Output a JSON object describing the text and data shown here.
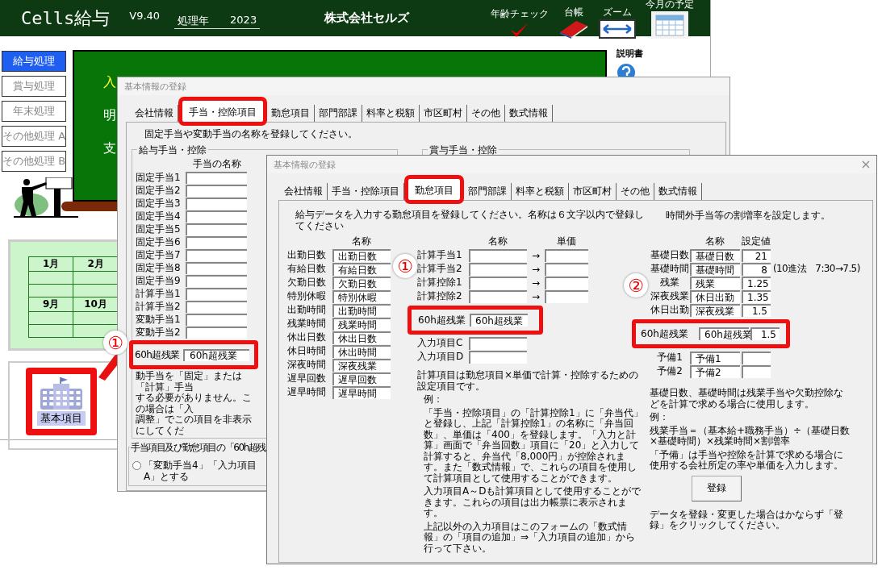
{
  "app": {
    "title": "Cells給与",
    "version": "V9.40",
    "year_label": "処理年",
    "year": "2023",
    "company": "株式会社セルズ",
    "tools": [
      {
        "label": "年齢チェック",
        "kind": "check"
      },
      {
        "label": "台帳",
        "kind": "book"
      },
      {
        "label": "ズーム",
        "kind": "zoom"
      },
      {
        "label": "今月の予定",
        "kind": "calendar"
      }
    ],
    "menu": [
      {
        "label": "給与処理",
        "selected": true
      },
      {
        "label": "賞与処理",
        "selected": false
      },
      {
        "label": "年末処理",
        "selected": false
      },
      {
        "label": "その他処理 A",
        "selected": false
      },
      {
        "label": "その他処理 B",
        "selected": false
      }
    ],
    "banner_chars": [
      {
        "text": "入",
        "color": "#ffff33"
      },
      {
        "text": "明",
        "color": "#ffffff"
      },
      {
        "text": "支",
        "color": "#ffffff"
      }
    ],
    "help": {
      "label": "説明書"
    },
    "calendar": {
      "rows": [
        [
          "1月",
          "2月"
        ],
        [
          null,
          null
        ],
        [
          null,
          null
        ],
        [
          "9月",
          "10月"
        ],
        [
          null,
          null
        ],
        [
          null,
          null
        ]
      ]
    },
    "launch_button": {
      "label": "基本項目"
    }
  },
  "back_dialog": {
    "title": "基本情報の登録",
    "tabs": [
      {
        "label": "会社情報",
        "selected": false
      },
      {
        "label": "手当・控除項目",
        "selected": true
      },
      {
        "label": "勤怠項目",
        "selected": false
      },
      {
        "label": "部門部課",
        "selected": false
      },
      {
        "label": "料率と税額",
        "selected": false
      },
      {
        "label": "市区町村",
        "selected": false
      },
      {
        "label": "その他",
        "selected": false
      },
      {
        "label": "数式情報",
        "selected": false
      }
    ],
    "instruction": "固定手当や変動手当の名称を登録してください。",
    "salary_group": "給与手当・控除",
    "bonus_group": "賞与手当・控除",
    "header": "手当の名称",
    "rows": [
      {
        "label": "固定手当1"
      },
      {
        "label": "固定手当2"
      },
      {
        "label": "固定手当3"
      },
      {
        "label": "固定手当4"
      },
      {
        "label": "固定手当5"
      },
      {
        "label": "固定手当6"
      },
      {
        "label": "固定手当7"
      },
      {
        "label": "固定手当8"
      },
      {
        "label": "固定手当9"
      },
      {
        "label": "計算手当1"
      },
      {
        "label": "計算手当2"
      },
      {
        "label": "変動手当1"
      },
      {
        "label": "変動手当2"
      }
    ],
    "marker": "①",
    "callout": {
      "label": "60h超残業",
      "value": "60h超残業"
    },
    "note_lines": [
      "動手当を「固定」または「計算」手当",
      "する必要がありません。この場合は「入",
      "調整」でこの項目を非表示にしてくだ"
    ],
    "bottom_group": "手当項目及び勤怠項目の「60h超残",
    "radio": {
      "label": "「変動手当4」「入力項目A」とする",
      "selected": false
    }
  },
  "front_dialog": {
    "title": "基本情報の登録",
    "tabs": [
      {
        "label": "会社情報",
        "selected": false
      },
      {
        "label": "手当・控除項目",
        "selected": false
      },
      {
        "label": "勤怠項目",
        "selected": true
      },
      {
        "label": "部門部課",
        "selected": false
      },
      {
        "label": "料率と税額",
        "selected": false
      },
      {
        "label": "市区町村",
        "selected": false
      },
      {
        "label": "その他",
        "selected": false
      },
      {
        "label": "数式情報",
        "selected": false
      }
    ],
    "instruction": "給与データを入力する勤怠項目を登録してください。名称は６文字以内で登録してください",
    "attendance": {
      "header": "名称",
      "rows": [
        {
          "label": "出勤日数",
          "value": "出勤日数"
        },
        {
          "label": "有給日数",
          "value": "有給日数"
        },
        {
          "label": "欠勤日数",
          "value": "欠勤日数"
        },
        {
          "label": "特別休暇",
          "value": "特別休暇"
        },
        {
          "label": "出勤時間",
          "value": "出勤時間"
        },
        {
          "label": "残業時間",
          "value": "残業時間"
        },
        {
          "label": "休出日数",
          "value": "休出日数"
        },
        {
          "label": "休日時間",
          "value": "休出時間"
        },
        {
          "label": "深夜時間",
          "value": "深夜残業"
        },
        {
          "label": "遅早回数",
          "value": "遅早回数"
        },
        {
          "label": "遅早時間",
          "value": "遅早時間"
        }
      ]
    },
    "calc": {
      "name_header": "名称",
      "unit_header": "単価",
      "rows": [
        {
          "label": "計算手当1",
          "arrow": "→"
        },
        {
          "label": "計算手当2",
          "arrow": "→"
        },
        {
          "label": "計算控除1",
          "arrow": "→"
        },
        {
          "label": "計算控除2",
          "arrow": "→"
        }
      ],
      "marker": "①",
      "callout": {
        "label": "60h超残業",
        "value": "60h超残業"
      },
      "inputs": [
        {
          "label": "入力項目C"
        },
        {
          "label": "入力項目D"
        }
      ]
    },
    "calc_notes": [
      "計算項目は勤怠項目×単価で計算・控除するための設定項目です。",
      "例：",
      "「手当・控除項目」の「計算控除1」に「弁当代」と登録し、上記「計算控除1」の名称に「弁当回数」、単価は「400」を登録します。「入力と計算」画面で「弁当回数」項目に「20」と入力して計算すると、弁当代「8,000円」が控除されます。また「数式情報」で、これらの項目を使用して計算項目として使用することができます。",
      "入力項目A～Dも計算項目として使用することができます。これらの項目は出力帳票に表示されます。",
      "上記以外の入力項目はこのフォームの「数式情報」の「項目の追加」⇒「入力項目の追加」から行って下さい。"
    ],
    "rates": {
      "intro": "時間外手当等の割増率を設定します。",
      "name_header": "名称",
      "value_header": "設定値",
      "rows": [
        {
          "label": "基礎日数",
          "name": "基礎日数",
          "value": "21"
        },
        {
          "label": "基礎時間",
          "name": "基礎時間",
          "value": "8",
          "note": "(10進法　7:30→7.5)"
        },
        {
          "label": "残業",
          "name": "残業",
          "value": "1.25"
        },
        {
          "label": "深夜残業",
          "name": "休日出勤",
          "value": "1.35"
        },
        {
          "label": "休日出勤",
          "name": "深夜残業",
          "value": "1.5"
        }
      ],
      "marker": "②",
      "callout": {
        "label": "60h超残業",
        "name": "60h超残業",
        "value": "1.5"
      },
      "spare": [
        {
          "label": "予備1",
          "name": "予備1"
        },
        {
          "label": "予備2",
          "name": "予備2"
        }
      ]
    },
    "rate_notes": [
      "基礎日数、基礎時間は残業手当や欠勤控除などを計算で求める場合に使用します。",
      "例：",
      "残業手当＝（基本給+職務手当）÷（基礎日数×基礎時間）×残業時間×割増率",
      "「予備」は手当や控除を計算で求める場合に使用する会社所定の率や単価を入力します。"
    ],
    "register_button": "登録",
    "footer_note": "データを登録・変更した場合はかならず「登録」をクリックしてください。"
  }
}
